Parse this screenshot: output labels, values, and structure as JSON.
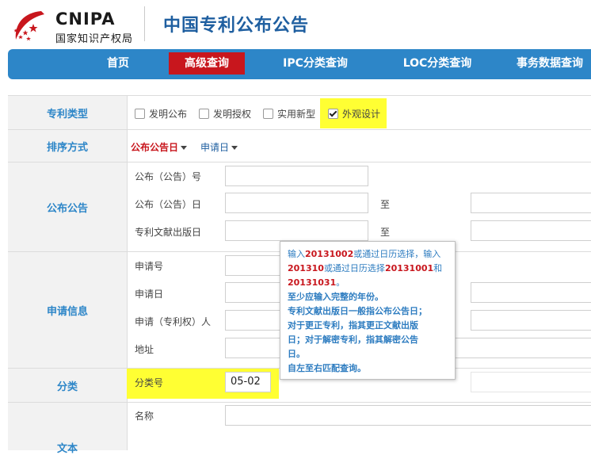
{
  "header": {
    "logo_en": "CNIPA",
    "logo_cn": "国家知识产权局",
    "site_title": "中国专利公布公告"
  },
  "nav": {
    "items": [
      "首页",
      "高级查询",
      "IPC分类查询",
      "LOC分类查询",
      "事务数据查询"
    ],
    "active_index": 1
  },
  "form": {
    "patent_type": {
      "label": "专利类型",
      "options": [
        {
          "text": "发明公布",
          "checked": false
        },
        {
          "text": "发明授权",
          "checked": false
        },
        {
          "text": "实用新型",
          "checked": false
        },
        {
          "text": "外观设计",
          "checked": true
        }
      ]
    },
    "sort": {
      "label": "排序方式",
      "options": [
        "公布公告日",
        "申请日"
      ]
    },
    "publication": {
      "label": "公布公告",
      "fields": [
        "公布（公告）号",
        "公布（公告）日",
        "专利文献出版日"
      ],
      "to": "至"
    },
    "application": {
      "label": "申请信息",
      "fields": [
        "申请号",
        "申请日",
        "申请（专利权）人",
        "地址"
      ]
    },
    "classification": {
      "label": "分类",
      "field": "分类号",
      "value": "05-02"
    },
    "text": {
      "label": "文本",
      "field": "名称"
    }
  },
  "tooltip": {
    "l1a": "输入",
    "l1b": "20131002",
    "l1c": "或通过日历选择，输入",
    "l2a": "201310",
    "l2b": "或通过日历选择",
    "l2c": "20131001",
    "l2d": "和",
    "l3a": "20131031",
    "l3b": "。",
    "l4": "至少应输入完整的年份。",
    "l5": "专利文献出版日一般指公布公告日；",
    "l6": "对于更正专利，指其更正文献出版",
    "l7": "日；对于解密专利，指其解密公告",
    "l8": "日。",
    "l9": "自左至右匹配查询。"
  }
}
